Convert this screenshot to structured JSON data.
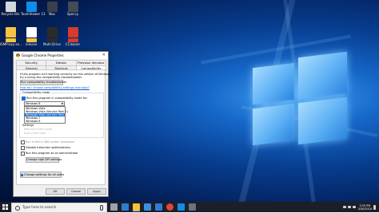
{
  "desktop": {
    "icons": [
      {
        "label": "Recycle Bin",
        "icon": "recycle-bin-icon",
        "color": "#cfd8dc"
      },
      {
        "label": "TeamViewer 13",
        "icon": "teamviewer-icon",
        "color": "#0e8ee9"
      },
      {
        "label": "Nox",
        "icon": "nox-icon",
        "color": "#3a3f4a"
      },
      {
        "label": "Speccy",
        "icon": "speccy-icon",
        "color": "#444b55"
      },
      {
        "label": "",
        "icon": "folder-icon",
        "color": "#f5c542"
      },
      {
        "label": "",
        "icon": "document-icon",
        "color": "#ffffff"
      },
      {
        "label": "",
        "icon": "multidrive-icon",
        "color": "#2b2b2b"
      },
      {
        "label": "",
        "icon": "ccleaner-icon",
        "color": "#d43c2c"
      },
      {
        "label": "ISMProxy-se...",
        "icon": "folder-icon",
        "color": "#f5c542"
      },
      {
        "label": "release",
        "icon": "folder-icon",
        "color": "#f5c542"
      },
      {
        "label": "Multi-Drive",
        "icon": "multidrive-icon",
        "color": "#2b2b2b"
      },
      {
        "label": "CCleaner",
        "icon": "ccleaner-icon",
        "color": "#d43c2c"
      }
    ]
  },
  "dialog": {
    "title": "Google Chrome Properties",
    "tabs_row1": [
      "Security",
      "Details",
      "Previous Versions"
    ],
    "tabs_row2": [
      "General",
      "Shortcut",
      "Compatibility"
    ],
    "intro": "If this program isn't working correctly on this version of Windows,",
    "intro2": "try running the compatibility troubleshooter.",
    "troubleshoot_button": "Run compatibility troubleshooter",
    "manual_link": "How do I choose compatibility settings manually?",
    "compat_mode_title": "Compatibility mode",
    "compat_checkbox": "Run this program in compatibility mode for:",
    "compat_selected": "Windows 8",
    "compat_options": [
      "Windows Vista",
      "Windows Vista (Service Pack 1)",
      "Windows Vista (Service Pack 2)",
      "Windows 7",
      "Windows 8"
    ],
    "selected_option_index": 2,
    "settings_title": "Settings",
    "faded_1": "Reduced color mode",
    "faded_2": "8-bit (256) color",
    "res_checkbox": "Run in 640 x 480 screen resolution",
    "fullscreen_checkbox": "Disable fullscreen optimizations",
    "admin_checkbox": "Run this program as an administrator",
    "high_dpi_button": "Change high DPI settings",
    "all_users_button": "Change settings for all users",
    "ok": "OK",
    "cancel": "Cancel",
    "apply": "Apply"
  },
  "taskbar": {
    "search_placeholder": "Type here to search",
    "time": "3:33 PM",
    "date": "3/30/2018",
    "apps": [
      {
        "icon": "task-view-icon",
        "color": "#9aa3b2"
      },
      {
        "icon": "edge-icon",
        "color": "#2c7cd6"
      },
      {
        "icon": "file-explorer-icon",
        "color": "#f3c340"
      },
      {
        "icon": "store-icon",
        "color": "#3b8fe0"
      },
      {
        "icon": "mail-icon",
        "color": "#2f7bd6"
      },
      {
        "icon": "chrome-icon",
        "color": "#e0463a"
      },
      {
        "icon": "teamviewer-icon",
        "color": "#0e8ee9"
      },
      {
        "icon": "app-icon",
        "color": "#6b7280"
      }
    ]
  }
}
